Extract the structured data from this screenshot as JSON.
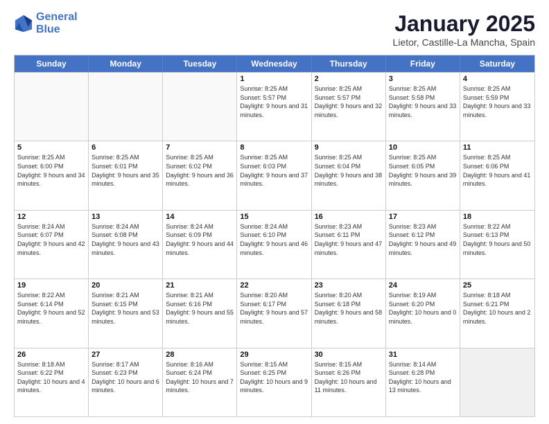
{
  "header": {
    "logo_line1": "General",
    "logo_line2": "Blue",
    "month_title": "January 2025",
    "subtitle": "Lietor, Castille-La Mancha, Spain"
  },
  "weekdays": [
    "Sunday",
    "Monday",
    "Tuesday",
    "Wednesday",
    "Thursday",
    "Friday",
    "Saturday"
  ],
  "rows": [
    [
      {
        "day": "",
        "text": "",
        "empty": true
      },
      {
        "day": "",
        "text": "",
        "empty": true
      },
      {
        "day": "",
        "text": "",
        "empty": true
      },
      {
        "day": "1",
        "text": "Sunrise: 8:25 AM\nSunset: 5:57 PM\nDaylight: 9 hours and 31 minutes."
      },
      {
        "day": "2",
        "text": "Sunrise: 8:25 AM\nSunset: 5:57 PM\nDaylight: 9 hours and 32 minutes."
      },
      {
        "day": "3",
        "text": "Sunrise: 8:25 AM\nSunset: 5:58 PM\nDaylight: 9 hours and 33 minutes."
      },
      {
        "day": "4",
        "text": "Sunrise: 8:25 AM\nSunset: 5:59 PM\nDaylight: 9 hours and 33 minutes."
      }
    ],
    [
      {
        "day": "5",
        "text": "Sunrise: 8:25 AM\nSunset: 6:00 PM\nDaylight: 9 hours and 34 minutes."
      },
      {
        "day": "6",
        "text": "Sunrise: 8:25 AM\nSunset: 6:01 PM\nDaylight: 9 hours and 35 minutes."
      },
      {
        "day": "7",
        "text": "Sunrise: 8:25 AM\nSunset: 6:02 PM\nDaylight: 9 hours and 36 minutes."
      },
      {
        "day": "8",
        "text": "Sunrise: 8:25 AM\nSunset: 6:03 PM\nDaylight: 9 hours and 37 minutes."
      },
      {
        "day": "9",
        "text": "Sunrise: 8:25 AM\nSunset: 6:04 PM\nDaylight: 9 hours and 38 minutes."
      },
      {
        "day": "10",
        "text": "Sunrise: 8:25 AM\nSunset: 6:05 PM\nDaylight: 9 hours and 39 minutes."
      },
      {
        "day": "11",
        "text": "Sunrise: 8:25 AM\nSunset: 6:06 PM\nDaylight: 9 hours and 41 minutes."
      }
    ],
    [
      {
        "day": "12",
        "text": "Sunrise: 8:24 AM\nSunset: 6:07 PM\nDaylight: 9 hours and 42 minutes."
      },
      {
        "day": "13",
        "text": "Sunrise: 8:24 AM\nSunset: 6:08 PM\nDaylight: 9 hours and 43 minutes."
      },
      {
        "day": "14",
        "text": "Sunrise: 8:24 AM\nSunset: 6:09 PM\nDaylight: 9 hours and 44 minutes."
      },
      {
        "day": "15",
        "text": "Sunrise: 8:24 AM\nSunset: 6:10 PM\nDaylight: 9 hours and 46 minutes."
      },
      {
        "day": "16",
        "text": "Sunrise: 8:23 AM\nSunset: 6:11 PM\nDaylight: 9 hours and 47 minutes."
      },
      {
        "day": "17",
        "text": "Sunrise: 8:23 AM\nSunset: 6:12 PM\nDaylight: 9 hours and 49 minutes."
      },
      {
        "day": "18",
        "text": "Sunrise: 8:22 AM\nSunset: 6:13 PM\nDaylight: 9 hours and 50 minutes."
      }
    ],
    [
      {
        "day": "19",
        "text": "Sunrise: 8:22 AM\nSunset: 6:14 PM\nDaylight: 9 hours and 52 minutes."
      },
      {
        "day": "20",
        "text": "Sunrise: 8:21 AM\nSunset: 6:15 PM\nDaylight: 9 hours and 53 minutes."
      },
      {
        "day": "21",
        "text": "Sunrise: 8:21 AM\nSunset: 6:16 PM\nDaylight: 9 hours and 55 minutes."
      },
      {
        "day": "22",
        "text": "Sunrise: 8:20 AM\nSunset: 6:17 PM\nDaylight: 9 hours and 57 minutes."
      },
      {
        "day": "23",
        "text": "Sunrise: 8:20 AM\nSunset: 6:18 PM\nDaylight: 9 hours and 58 minutes."
      },
      {
        "day": "24",
        "text": "Sunrise: 8:19 AM\nSunset: 6:20 PM\nDaylight: 10 hours and 0 minutes."
      },
      {
        "day": "25",
        "text": "Sunrise: 8:18 AM\nSunset: 6:21 PM\nDaylight: 10 hours and 2 minutes."
      }
    ],
    [
      {
        "day": "26",
        "text": "Sunrise: 8:18 AM\nSunset: 6:22 PM\nDaylight: 10 hours and 4 minutes."
      },
      {
        "day": "27",
        "text": "Sunrise: 8:17 AM\nSunset: 6:23 PM\nDaylight: 10 hours and 6 minutes."
      },
      {
        "day": "28",
        "text": "Sunrise: 8:16 AM\nSunset: 6:24 PM\nDaylight: 10 hours and 7 minutes."
      },
      {
        "day": "29",
        "text": "Sunrise: 8:15 AM\nSunset: 6:25 PM\nDaylight: 10 hours and 9 minutes."
      },
      {
        "day": "30",
        "text": "Sunrise: 8:15 AM\nSunset: 6:26 PM\nDaylight: 10 hours and 11 minutes."
      },
      {
        "day": "31",
        "text": "Sunrise: 8:14 AM\nSunset: 6:28 PM\nDaylight: 10 hours and 13 minutes."
      },
      {
        "day": "",
        "text": "",
        "empty": true
      }
    ]
  ]
}
